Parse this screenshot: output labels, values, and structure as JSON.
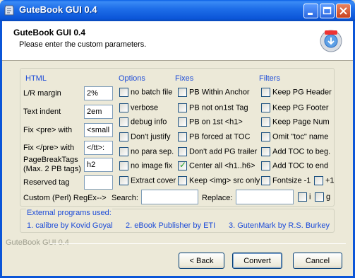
{
  "window": {
    "title": "GuteBook GUI 0.4",
    "header_title": "GuteBook GUI 0.4",
    "header_subtitle": "Please enter the custom parameters."
  },
  "html_section": {
    "heading": "HTML",
    "fields": [
      {
        "label": "L/R margin",
        "value": "2%"
      },
      {
        "label": "Text indent",
        "value": "2em"
      },
      {
        "label": "Fix <pre> with",
        "value": "<small"
      },
      {
        "label": "Fix </pre> with",
        "value": "</tt>:"
      },
      {
        "label_line1": "PageBreakTags",
        "label_line2": "(Max. 2 PB tags)",
        "value": "h2"
      },
      {
        "label": "Reserved tag",
        "value": ""
      }
    ],
    "regex_label": "Custom (Perl) RegEx-->"
  },
  "options": {
    "heading": "Options",
    "items": [
      {
        "label": "no batch file",
        "checked": false
      },
      {
        "label": "verbose",
        "checked": false
      },
      {
        "label": "debug info",
        "checked": false
      },
      {
        "label": "Don't justify",
        "checked": false
      },
      {
        "label": "no para sep.",
        "checked": false
      },
      {
        "label": "no image fix",
        "checked": false
      },
      {
        "label": "Extract cover",
        "checked": false
      }
    ]
  },
  "fixes": {
    "heading": "Fixes",
    "items": [
      {
        "label": "PB Within Anchor",
        "checked": false
      },
      {
        "label": "PB not on1st Tag",
        "checked": false
      },
      {
        "label": "PB on 1st <h1>",
        "checked": false
      },
      {
        "label": "PB forced at TOC",
        "checked": false
      },
      {
        "label": "Don't add PG trailer",
        "checked": false
      },
      {
        "label": "Center all <h1..h6>",
        "checked": true
      },
      {
        "label": "Keep <img> src only",
        "checked": false
      }
    ]
  },
  "filters": {
    "heading": "Filters",
    "items": [
      {
        "label": "Keep PG Header",
        "checked": false
      },
      {
        "label": "Keep PG Footer",
        "checked": false
      },
      {
        "label": "Keep Page Num",
        "checked": false
      },
      {
        "label": "Omit \"toc\" name",
        "checked": false
      },
      {
        "label": "Add TOC to beg.",
        "checked": false
      },
      {
        "label": "Add TOC to end",
        "checked": false
      }
    ],
    "fontsize_label": "Fontsize -1",
    "fontsize_plus_label": "+1"
  },
  "search": {
    "label": "Search:",
    "value": "",
    "replace_label": "Replace:",
    "replace_value": "",
    "i_label": "i",
    "g_label": "g"
  },
  "external": {
    "heading": "External programs used:",
    "links": [
      "1. calibre by Kovid Goyal",
      "2. eBook Publisher by ETI",
      "3. GutenMark by R.S. Burkey"
    ]
  },
  "footer": {
    "brand": "GuteBook GUI 0.4",
    "back_label": "< Back",
    "convert_label": "Convert",
    "cancel_label": "Cancel"
  },
  "colors": {
    "titlebar": "#0b55d8",
    "link_blue": "#1c4bd8",
    "checkmark": "#21a121",
    "dialog_bg": "#ece9d8"
  }
}
